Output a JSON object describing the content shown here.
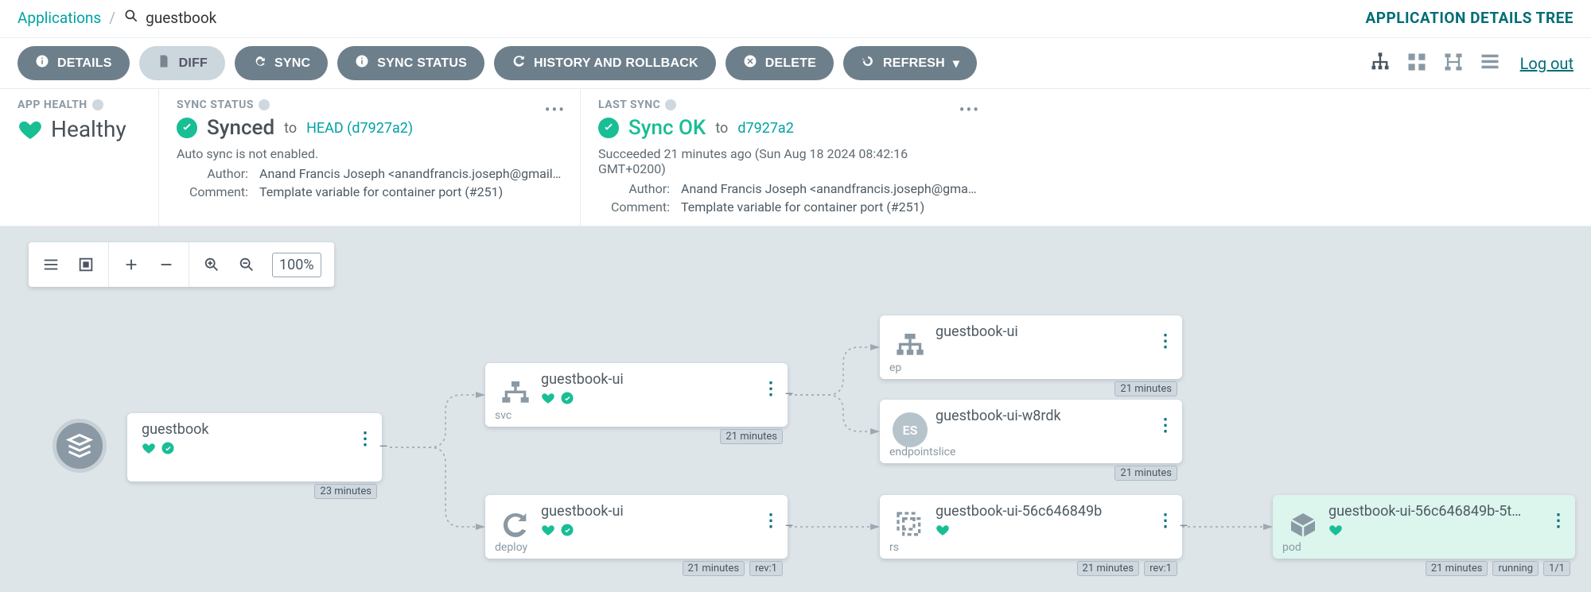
{
  "breadcrumb": {
    "root": "Applications",
    "app": "guestbook"
  },
  "page_title": "APPLICATION DETAILS TREE",
  "toolbar": {
    "details": "DETAILS",
    "diff": "DIFF",
    "sync": "SYNC",
    "sync_status": "SYNC STATUS",
    "history": "HISTORY AND ROLLBACK",
    "delete": "DELETE",
    "refresh": "REFRESH",
    "logout": "Log out"
  },
  "panels": {
    "health": {
      "header": "APP HEALTH",
      "label": "Healthy"
    },
    "sync": {
      "header": "SYNC STATUS",
      "label": "Synced",
      "to": "to",
      "rev": "HEAD (d7927a2)",
      "sub": "Auto sync is not enabled.",
      "author_k": "Author:",
      "author_v": "Anand Francis Joseph <anandfrancis.joseph@gmail.c…",
      "comment_k": "Comment:",
      "comment_v": "Template variable for container port (#251)"
    },
    "last": {
      "header": "LAST SYNC",
      "label": "Sync OK",
      "to": "to",
      "rev": "d7927a2",
      "sub": "Succeeded 21 minutes ago (Sun Aug 18 2024 08:42:16 GMT+0200)",
      "author_k": "Author:",
      "author_v": "Anand Francis Joseph <anandfrancis.joseph@gmail.c…",
      "comment_k": "Comment:",
      "comment_v": "Template variable for container port (#251)"
    }
  },
  "zoom": {
    "pct": "100%"
  },
  "nodes": {
    "app": {
      "title": "guestbook",
      "age": "23 minutes"
    },
    "svc": {
      "title": "guestbook-ui",
      "kind": "svc",
      "age": "21 minutes"
    },
    "deploy": {
      "title": "guestbook-ui",
      "kind": "deploy",
      "age": "21 minutes",
      "rev": "rev:1"
    },
    "ep": {
      "title": "guestbook-ui",
      "kind": "ep",
      "age": "21 minutes"
    },
    "es": {
      "title": "guestbook-ui-w8rdk",
      "kind": "endpointslice",
      "es_label": "ES",
      "age": "21 minutes"
    },
    "rs": {
      "title": "guestbook-ui-56c646849b",
      "kind": "rs",
      "age": "21 minutes",
      "rev": "rev:1"
    },
    "pod": {
      "title": "guestbook-ui-56c646849b-5t…",
      "kind": "pod",
      "age": "21 minutes",
      "status": "running",
      "count": "1/1"
    }
  }
}
